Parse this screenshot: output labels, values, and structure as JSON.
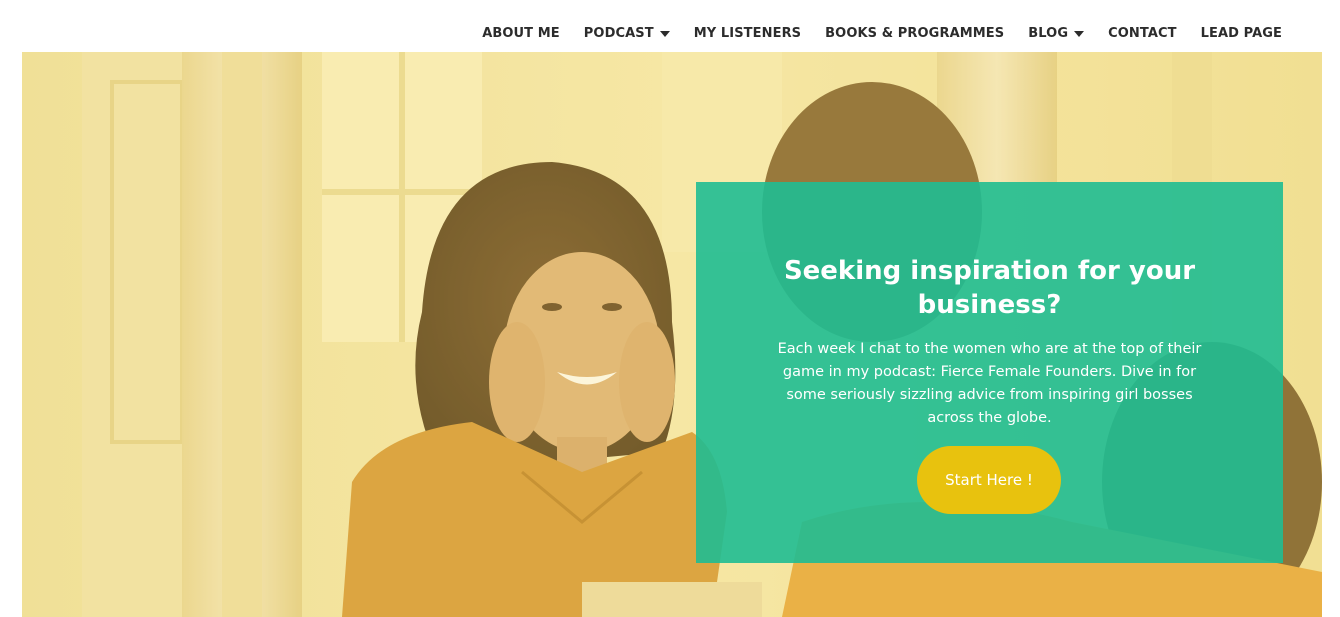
{
  "nav": {
    "items": [
      {
        "label": "ABOUT ME",
        "dropdown": false
      },
      {
        "label": "PODCAST",
        "dropdown": true
      },
      {
        "label": "MY LISTENERS",
        "dropdown": false
      },
      {
        "label": "BOOKS & PROGRAMMES",
        "dropdown": false
      },
      {
        "label": "BLOG",
        "dropdown": true
      },
      {
        "label": "CONTACT",
        "dropdown": false
      },
      {
        "label": "LEAD PAGE",
        "dropdown": false
      }
    ]
  },
  "hero": {
    "image_description": "smiling-woman-looking-in-mirror",
    "overlay_tint": "#f2d86a"
  },
  "callout": {
    "title": "Seeking inspiration for your business?",
    "text": "Each week I chat to the women who are at the top of their game in my podcast: Fierce Female Founders. Dive in for some seriously sizzling advice from inspiring girl bosses across the globe.",
    "cta_label": "Start Here !",
    "background_color": "#1fbd92",
    "cta_color": "#e8c20e"
  }
}
